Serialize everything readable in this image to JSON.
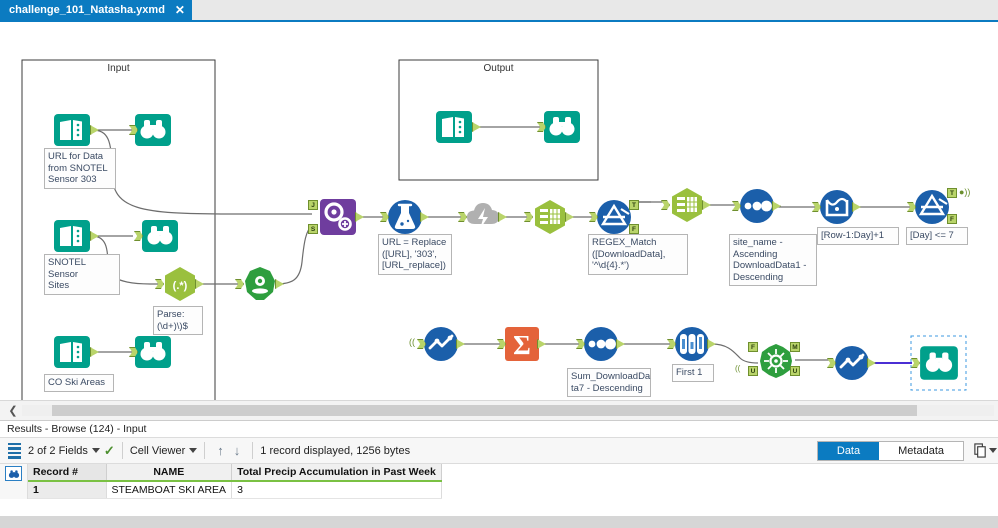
{
  "tab": {
    "title": "challenge_101_Natasha.yxmd",
    "close_icon": "close-icon"
  },
  "canvas": {
    "containers": [
      {
        "title": "Input"
      },
      {
        "title": "Output"
      }
    ],
    "annotations": {
      "url_for_data": "URL for Data\nfrom SNOTEL\nSensor 303",
      "snotel_sites": "SNOTEL Sensor\nSites",
      "co_ski_areas": "CO Ski Areas",
      "parse_regex": "Parse:\n(\\d+)\\)$",
      "formula_url": "URL = Replace\n([URL], '303',\n[URL_replace])",
      "regex_match": "REGEX_Match\n([DownloadData],\n'^\\d{4}.*')",
      "sort_site_name": "site_name -\nAscending\nDownloadData1 -\nDescending",
      "multirow_formula": "[Row-1:Day]+1",
      "filter_day": "[Day] <= 7",
      "sort_sum": "Sum_DownloadDa\nta7 - Descending",
      "sample_first": "First 1"
    },
    "tool_names": {
      "text_input": "text-input-tool",
      "browse": "browse-tool",
      "regex": "regex-tool",
      "find_location": "find-location-tool",
      "join": "join-tool",
      "formula": "formula-tool",
      "download": "download-tool",
      "select": "select-tool",
      "filter": "filter-tool",
      "sort": "sort-tool",
      "multi_row_formula": "multi-row-formula-tool",
      "data_cleansing": "data-cleansing-tool",
      "summarize": "summarize-tool",
      "sample": "sample-tool",
      "find_replace": "find-replace-tool"
    },
    "port_labels": {
      "join_j": "J",
      "join_s": "S",
      "filter_t": "T",
      "filter_f": "F",
      "findreplace_f": "F",
      "findreplace_u": "U",
      "findreplace_m": "M"
    }
  },
  "scroll": {
    "left_chevron": "chevron-left-icon"
  },
  "results": {
    "header": "Results - Browse (124) - Input",
    "toolbar": {
      "fields_label": "2 of 2 Fields",
      "viewer_label": "Cell Viewer",
      "up_arrow": "↑",
      "down_arrow": "↓",
      "record_status": "1 record displayed, 1256 bytes",
      "data_tab": "Data",
      "metadata_tab": "Metadata",
      "active_tab": "Data"
    },
    "grid": {
      "columns": [
        "Record #",
        "NAME",
        "Total Precip Accumulation in Past Week"
      ],
      "rows": [
        [
          "1",
          "STEAMBOAT SKI AREA",
          "3"
        ]
      ]
    }
  },
  "colors": {
    "accent_blue": "#0b7bc1",
    "teal": "#00a08b",
    "green_tool": "#9ac03e",
    "blue_tool": "#1b5faa",
    "purple_tool": "#6f3d9e",
    "orange_tool": "#e4633a",
    "grey_tool": "#b0b0b0",
    "dark_green": "#2e9e3e",
    "header_underline": "#7ac143"
  }
}
